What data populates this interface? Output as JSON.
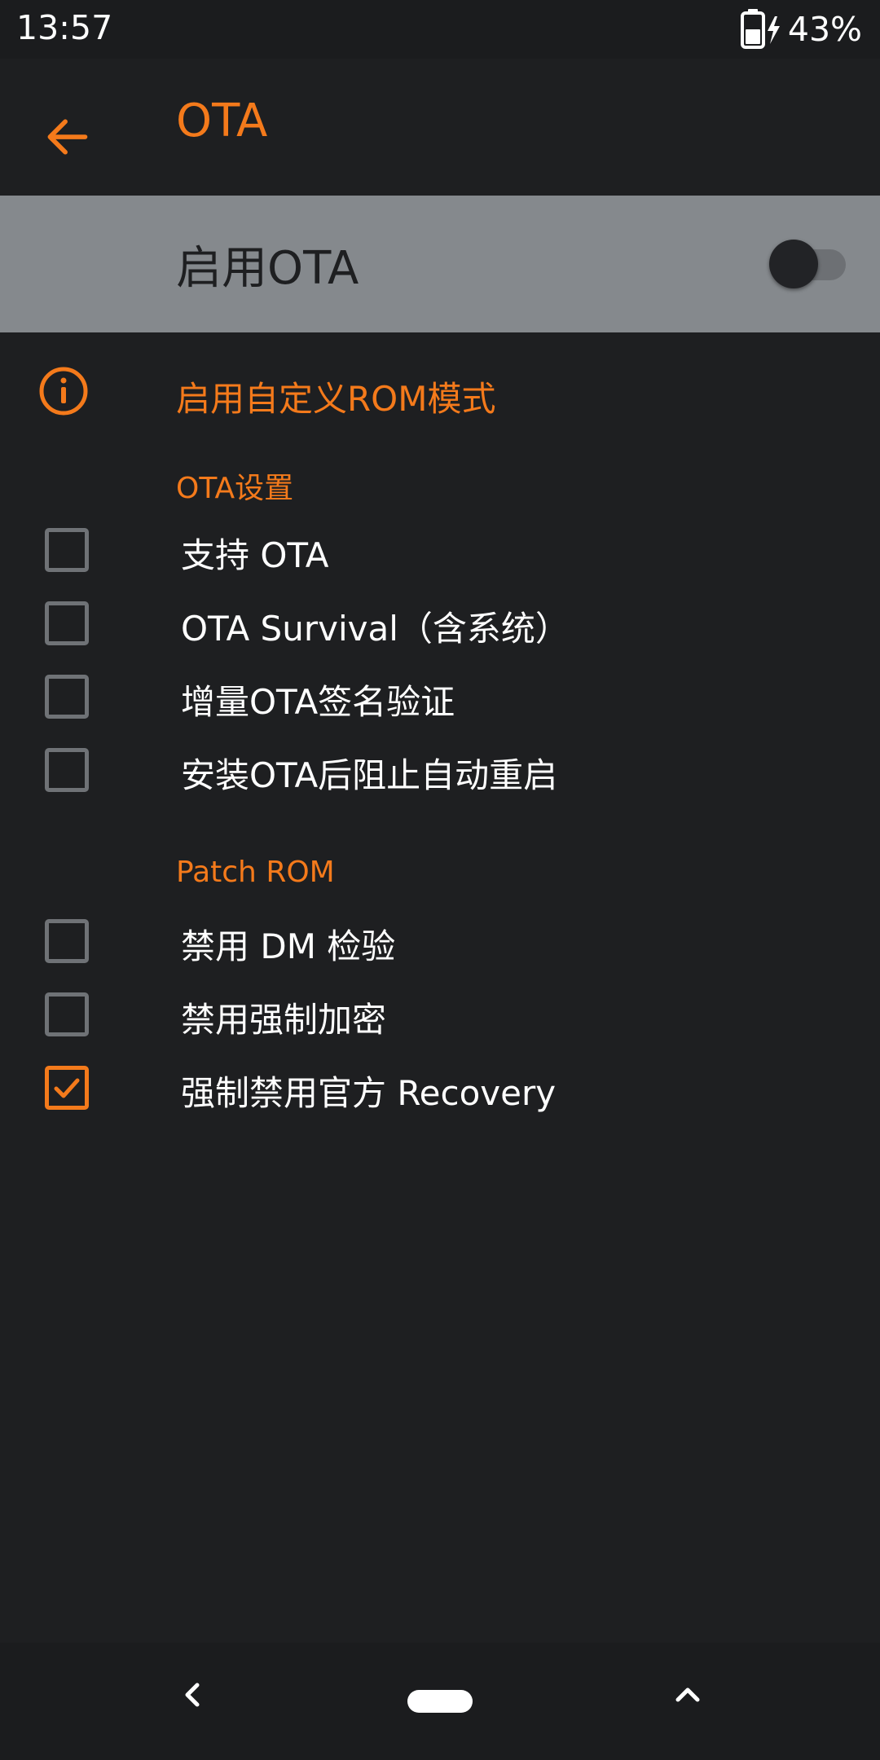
{
  "status_bar": {
    "time": "13:57",
    "battery_percent": "43%",
    "battery_icon": "battery-charging-icon"
  },
  "app_bar": {
    "back_icon": "arrow-left-icon",
    "title": "OTA"
  },
  "master_switch": {
    "label": "启用OTA",
    "checked": false
  },
  "info": {
    "icon": "info-icon",
    "text": "启用自定义ROM模式"
  },
  "sections": {
    "ota_settings": {
      "header": "OTA设置",
      "items": [
        {
          "label": "支持 OTA",
          "checked": false
        },
        {
          "label": "OTA Survival（含系统）",
          "checked": false
        },
        {
          "label": "增量OTA签名验证",
          "checked": false
        },
        {
          "label": "安装OTA后阻止自动重启",
          "checked": false
        }
      ]
    },
    "patch_rom": {
      "header": "Patch ROM",
      "items": [
        {
          "label": "禁用 DM 检验",
          "checked": false
        },
        {
          "label": "禁用强制加密",
          "checked": false
        },
        {
          "label": "强制禁用官方 Recovery",
          "checked": true
        }
      ]
    }
  },
  "nav_bar": {
    "back_icon": "chevron-left-icon",
    "home_icon": "home-pill-icon",
    "up_icon": "chevron-up-icon"
  },
  "colors": {
    "accent": "#f47a1b",
    "background": "#1e1f21",
    "master_row": "#85898d",
    "checkbox_border": "#6f7276"
  }
}
